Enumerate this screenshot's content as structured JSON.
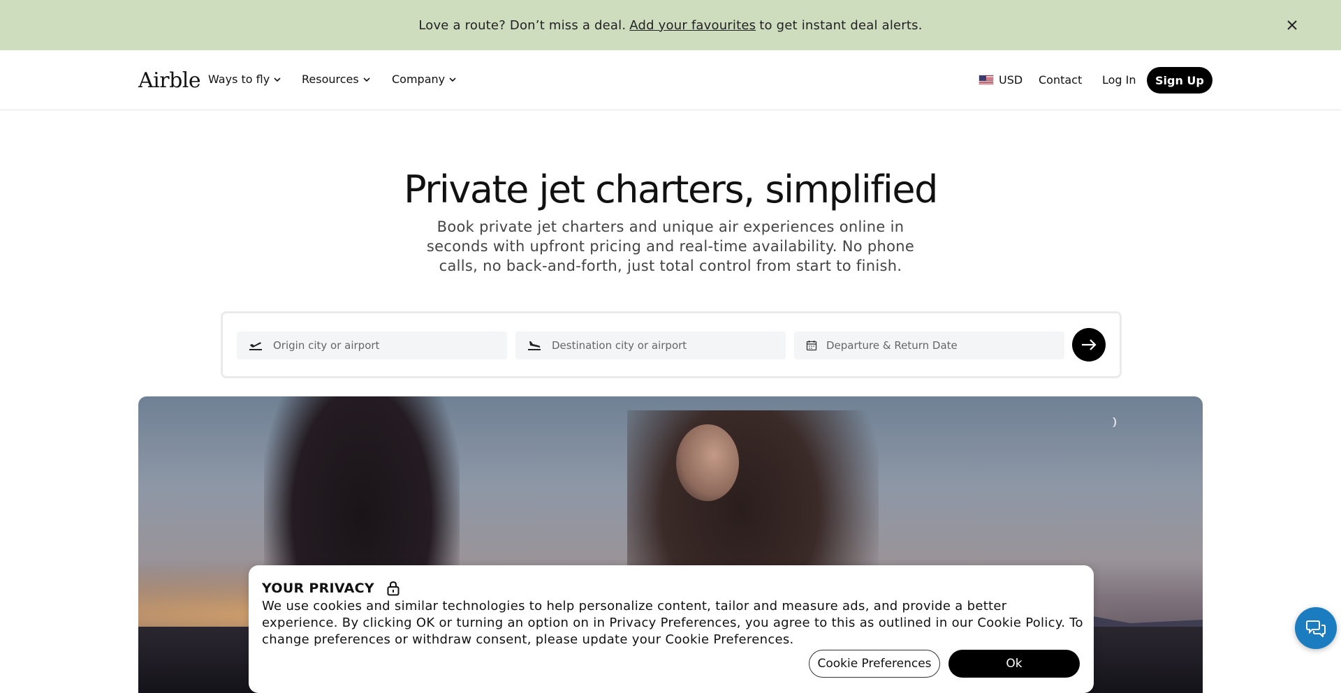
{
  "promo": {
    "text_before": "Love a route? Don’t miss a deal.",
    "link": "Add your favourites",
    "text_after": "to get instant deal alerts.",
    "close_icon": "close-icon"
  },
  "header": {
    "logo": "Airble",
    "nav": [
      {
        "label": "Ways to fly"
      },
      {
        "label": "Resources"
      },
      {
        "label": "Company"
      }
    ],
    "currency": "USD",
    "contact": "Contact",
    "login": "Log In",
    "signup": "Sign Up"
  },
  "hero": {
    "title": "Private jet charters, simplified",
    "subtitle": "Book private jet charters and unique air experiences online in seconds with upfront pricing and real-time availability. No phone calls, no back-and-forth, just total control from start to finish."
  },
  "search": {
    "origin_placeholder": "Origin city or airport",
    "destination_placeholder": "Destination city or airport",
    "date_placeholder": "Departure & Return Date"
  },
  "cookie": {
    "title": "YOUR PRIVACY",
    "body": "We use cookies and similar technologies to help personalize content, tailor and measure ads, and provide a better experience. By clicking OK or turning an option on in Privacy Preferences, you agree to this as outlined in our Cookie Policy. To change preferences or withdraw consent, please update your Cookie Preferences.",
    "preferences_label": "Cookie Preferences",
    "ok_label": "Ok"
  },
  "colors": {
    "promo_bg": "#cfddbf",
    "accent": "#000000",
    "chat": "#1b7cc0"
  }
}
